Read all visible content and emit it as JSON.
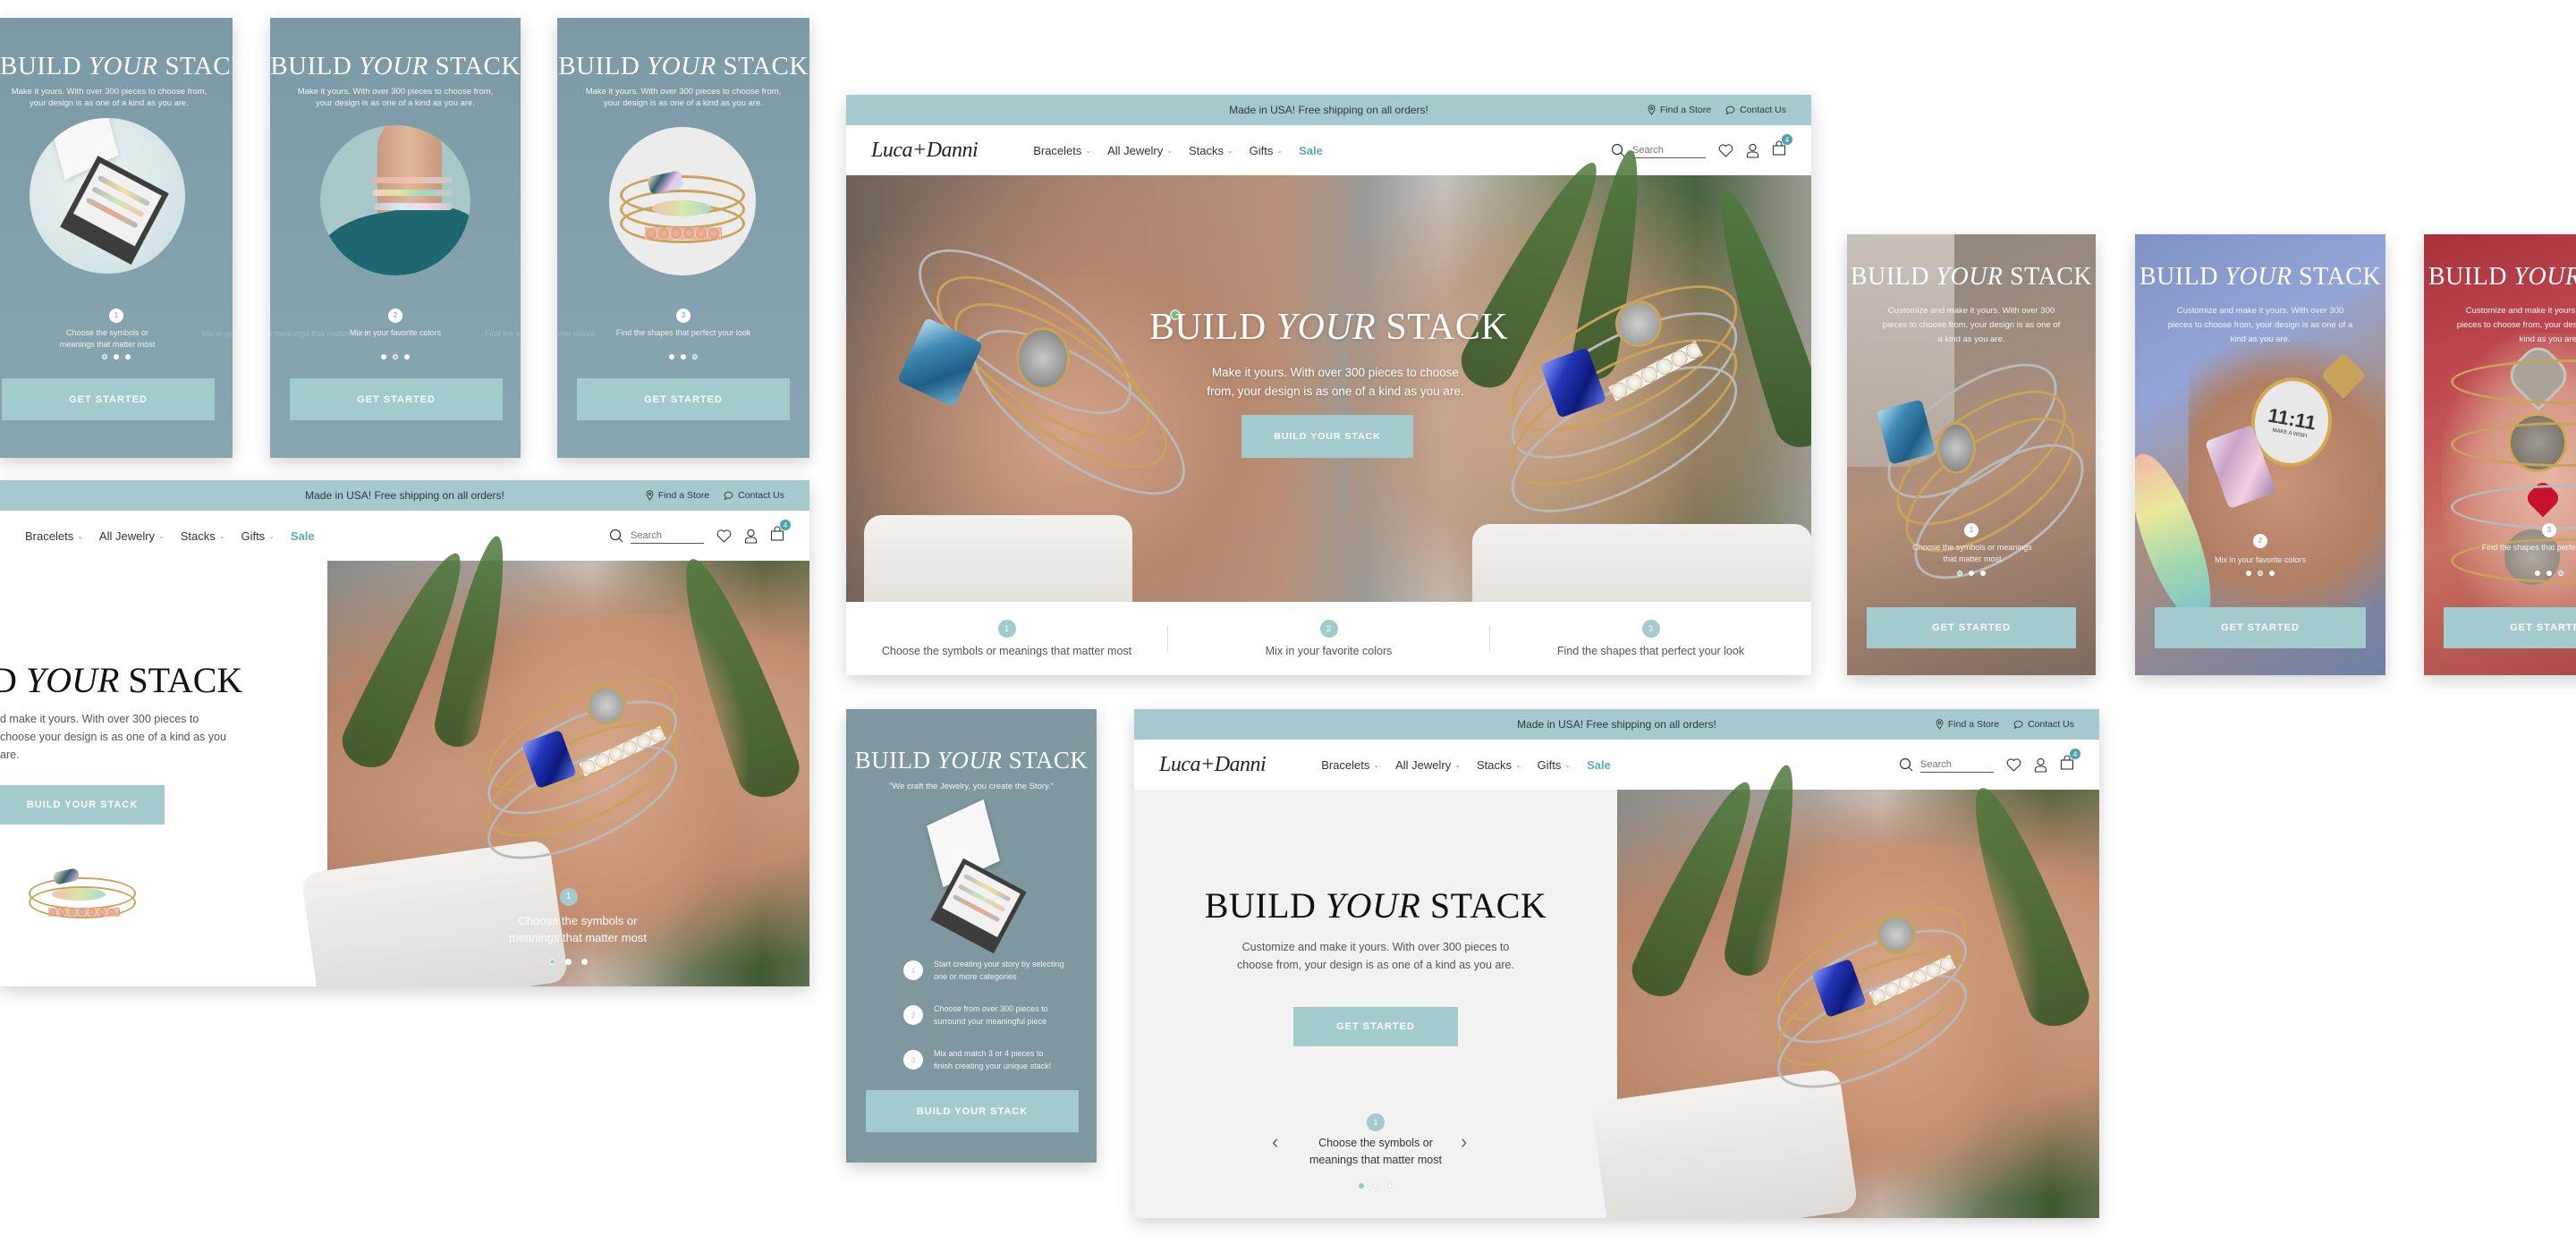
{
  "brand": {
    "logo_text": "Luca+Danni",
    "accent_color": "#a4cacd",
    "sale_color": "#5faab0",
    "mobile_bg_color": "#7b9aa6"
  },
  "header": {
    "announcement": "Made in USA! Free shipping on all orders!",
    "find_store": "Find a Store",
    "contact_us": "Contact Us",
    "nav": [
      {
        "label": "Bracelets",
        "has_dropdown": true
      },
      {
        "label": "All Jewelry",
        "has_dropdown": true
      },
      {
        "label": "Stacks",
        "has_dropdown": true
      },
      {
        "label": "Gifts",
        "has_dropdown": true
      },
      {
        "label": "Sale",
        "has_dropdown": false
      }
    ],
    "search_placeholder": "Search",
    "cart_count": "4",
    "icons": [
      "search-icon",
      "heart-icon",
      "user-icon",
      "cart-icon",
      "map-pin-icon",
      "chat-icon"
    ]
  },
  "hero": {
    "title_pre": "BUILD",
    "title_em": "YOUR",
    "title_post": "STACK",
    "subtitle_short": "Make it yours. With over 300 pieces to choose from, your design is as one of a kind as you are.",
    "subtitle_long": "Customize and make it yours. With over 300 pieces to choose from, your design is as one of a kind as you are.",
    "subtitle_cropped": "d make it yours. With over 300 pieces to choose your design is as one of a kind as you are.",
    "title_cropped": "D",
    "cta_build": "BUILD YOUR STACK",
    "cta_start": "GET STARTED",
    "quote": "\"We craft the Jewelry, you create the Story.\""
  },
  "steps": [
    {
      "num": "1",
      "text": "Choose the symbols or meanings that matter most"
    },
    {
      "num": "2",
      "text": "Mix in your favorite colors"
    },
    {
      "num": "3",
      "text": "Find the shapes that perfect your look"
    }
  ],
  "steps_detailed": [
    {
      "num": "1",
      "text": "Start creating your story by selecting one or more categories"
    },
    {
      "num": "2",
      "text": "Choose from over 300 pieces to surround your meaningful piece"
    },
    {
      "num": "3",
      "text": "Mix and match 3 or 4 pieces to finish creating your unique stack!"
    }
  ],
  "carousel": {
    "mobile_1_active": 1,
    "mobile_2_active": 2,
    "mobile_3_active": 3,
    "total": 3
  },
  "ghost": {
    "a": "Mix in your favorite colors",
    "b": "Choose the symbols or meanings that matter most",
    "c": "Find the shapes that perfect your look"
  },
  "nav_arrows": {
    "prev": "‹",
    "next": "›"
  },
  "photo_labels": {
    "wish": "11:11",
    "wish_sub": "MAKE A WISH"
  }
}
